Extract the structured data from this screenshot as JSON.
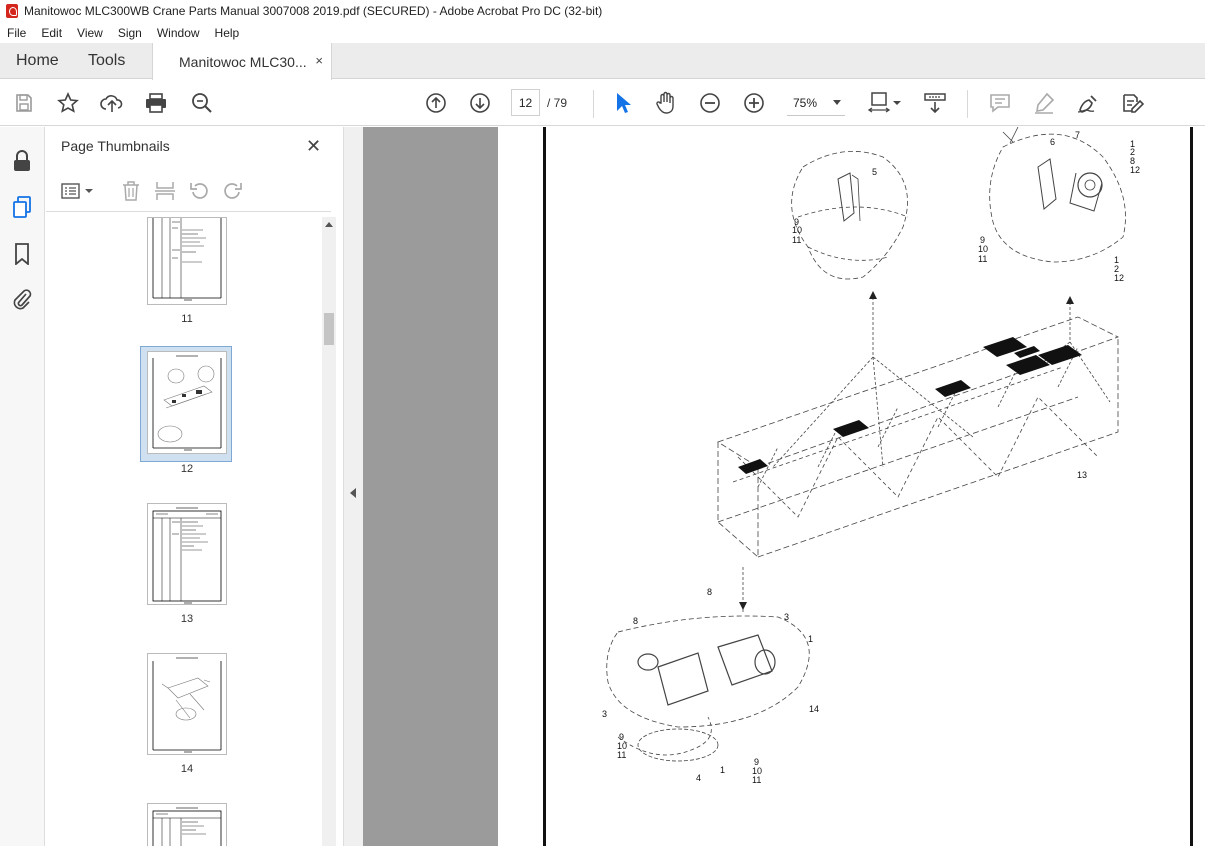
{
  "window": {
    "title": "Manitowoc MLC300WB Crane Parts Manual 3007008 2019.pdf (SECURED) - Adobe Acrobat Pro DC (32-bit)"
  },
  "menu": [
    "File",
    "Edit",
    "View",
    "Sign",
    "Window",
    "Help"
  ],
  "tabs": {
    "home": "Home",
    "tools": "Tools",
    "document": "Manitowoc MLC30...",
    "close": "×"
  },
  "toolbar": {
    "page_current": "12",
    "page_total": "/ 79",
    "zoom": "75%"
  },
  "panel": {
    "title": "Page Thumbnails",
    "close": "✕"
  },
  "thumbnails": [
    {
      "label": "11",
      "selected": false
    },
    {
      "label": "12",
      "selected": true
    },
    {
      "label": "13",
      "selected": false
    },
    {
      "label": "14",
      "selected": false
    }
  ],
  "callouts": [
    "5",
    "9",
    "10",
    "11",
    "6",
    "7",
    "1",
    "2",
    "8",
    "12",
    "9",
    "10",
    "11",
    "1",
    "2",
    "12",
    "13",
    "8",
    "3",
    "1",
    "8",
    "14",
    "3",
    "9",
    "10",
    "11",
    "4",
    "1",
    "9",
    "10",
    "11"
  ],
  "colors": {
    "accent": "#1473e6",
    "viewer_bg": "#9b9b9b",
    "tab_bg": "#ececec"
  }
}
